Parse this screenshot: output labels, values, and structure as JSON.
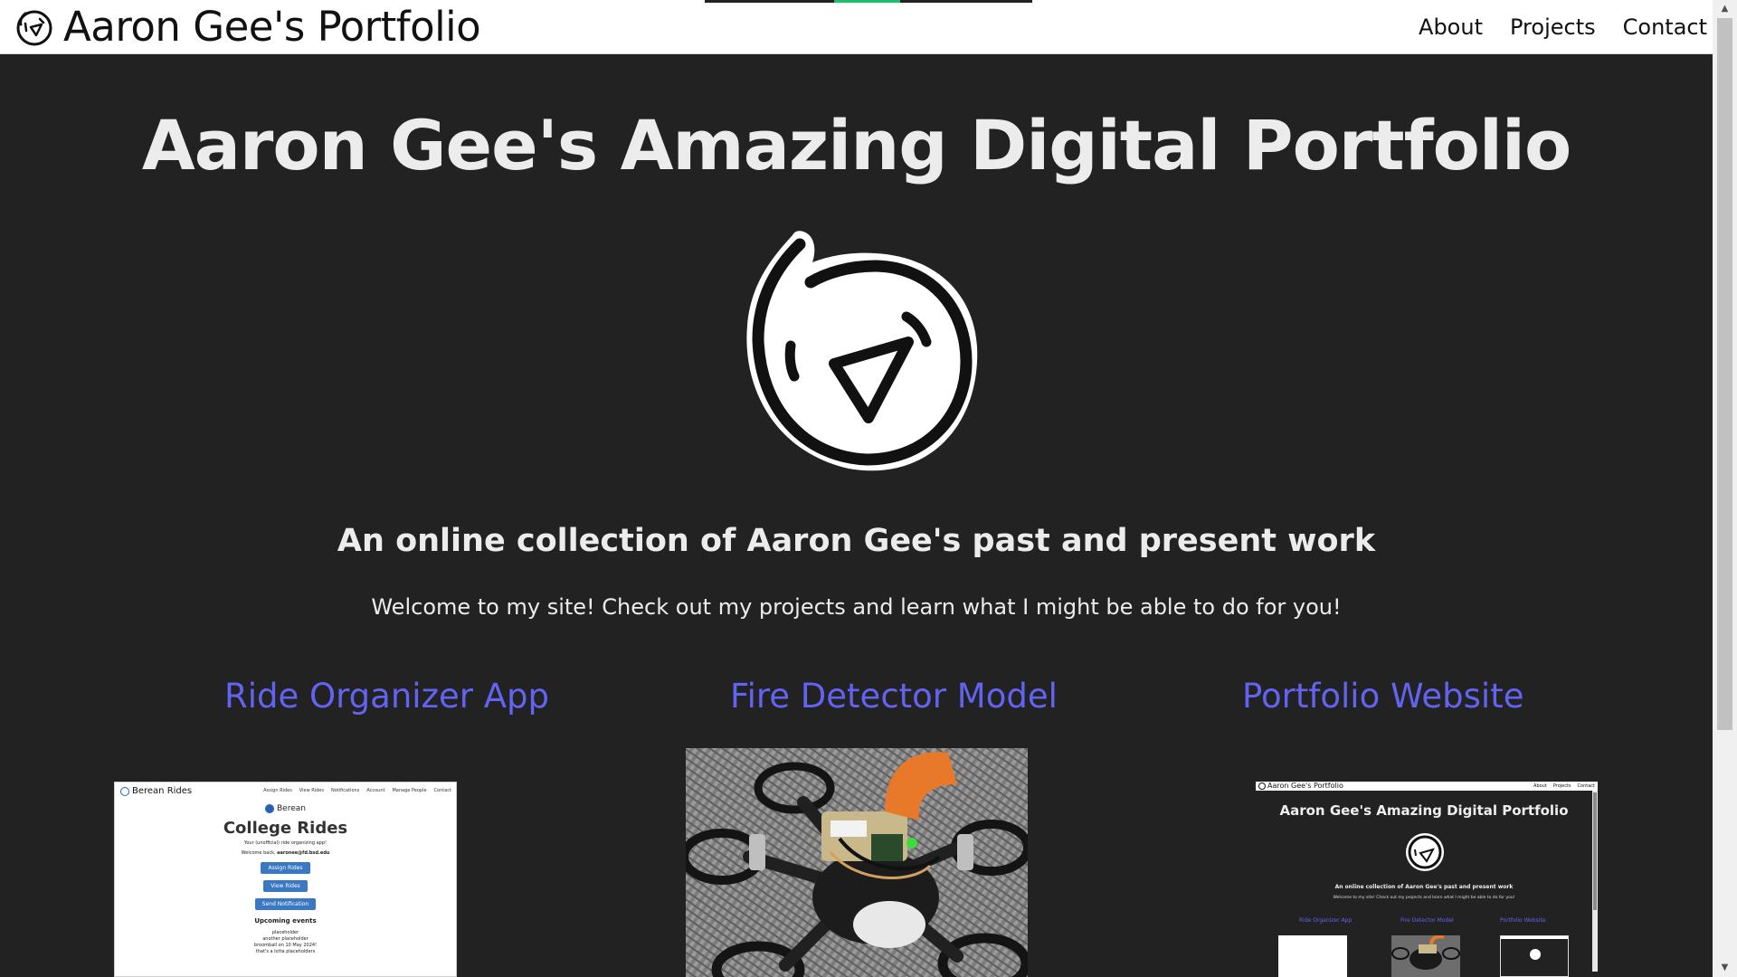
{
  "header": {
    "brand_text": "Aaron Gee's Portfolio",
    "nav_links": [
      "About",
      "Projects",
      "Contact"
    ]
  },
  "loading_progress": {
    "fill_start_fraction": 0.395,
    "fill_end_fraction": 0.597,
    "fill_color": "#1ebf6b"
  },
  "hero": {
    "title": "Aaron Gee's Amazing Digital Portfolio",
    "subtitle": "An online collection of Aaron Gee's past and present work",
    "welcome": "Welcome to my site! Check out my projects and learn what I might be able to do for you!"
  },
  "projects": [
    {
      "title": "Ride Organizer App"
    },
    {
      "title": "Fire Detector Model"
    },
    {
      "title": "Portfolio Website"
    }
  ],
  "ride_app_preview": {
    "brand": "Berean Rides",
    "nav": [
      "Assign Rides",
      "View Rides",
      "Notifications",
      "Account",
      "Manage People",
      "Contact"
    ],
    "logo_text": "Berean",
    "title": "College Rides",
    "tagline": "Your (unofficial) ride organizing app!",
    "welcome_prefix": "Welcome back, ",
    "welcome_email": "aaronee@fd.bsd.edu",
    "buttons": [
      "Assign Rides",
      "View Rides",
      "Send Notification"
    ],
    "events_heading": "Upcoming events",
    "events": [
      "placeholder",
      "another placeholder",
      "broomball on 10 May 2024!",
      "that's a lotta placeholders"
    ]
  },
  "portfolio_preview": {
    "brand": "Aaron Gee's Portfolio",
    "nav": [
      "About",
      "Projects",
      "Contact"
    ],
    "title": "Aaron Gee's Amazing Digital Portfolio",
    "subtitle": "An online collection of Aaron Gee's past and present work",
    "welcome": "Welcome to my site! Check out my projects and learn what I might be able to do for you!",
    "projects": [
      "Ride Organizer App",
      "Fire Detector Model",
      "Portfolio Website"
    ]
  },
  "colors": {
    "background": "#222222",
    "text": "#ececec",
    "link": "#6363f2",
    "navbar": "#ffffff"
  },
  "icons": {
    "brand_logo": "smiley-logo-icon",
    "scroll_up": "chevron-up-icon",
    "scroll_down": "chevron-down-icon"
  }
}
